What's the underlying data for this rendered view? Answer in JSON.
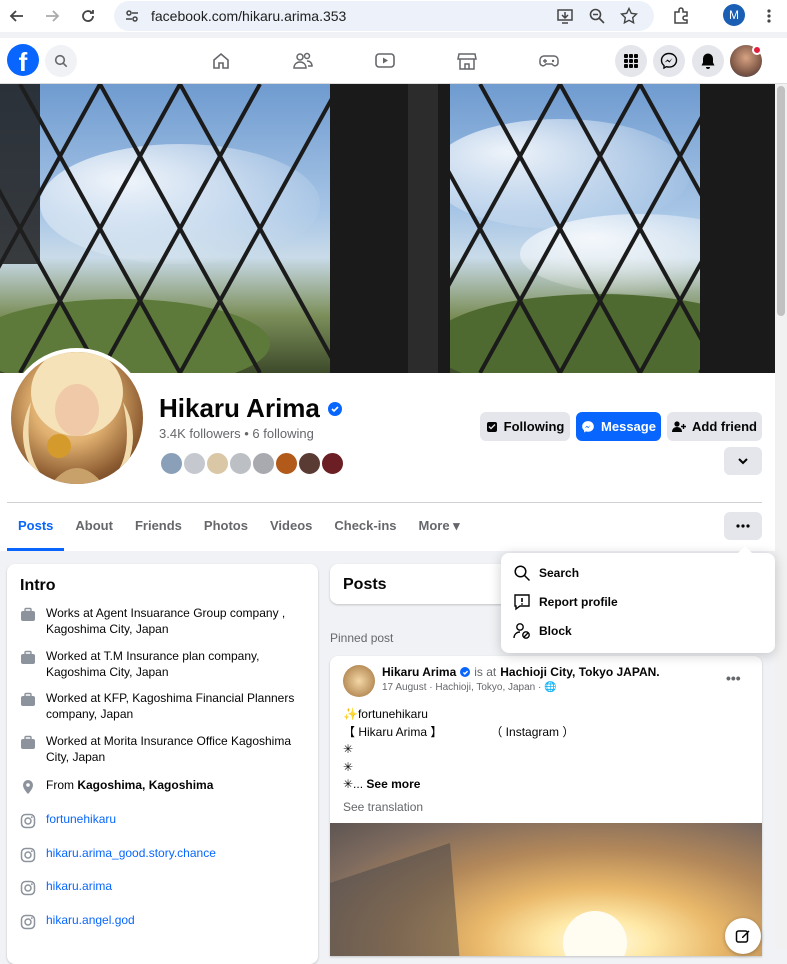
{
  "browser": {
    "url": "facebook.com/hikaru.arima.353",
    "profile_initial": "M"
  },
  "fb": {
    "logo_letter": "f"
  },
  "profile": {
    "name": "Hikaru Arima",
    "followers_line": "3.4K followers • 6 following",
    "buttons": {
      "following": "Following",
      "message": "Message",
      "add_friend": "Add friend"
    }
  },
  "tabs": [
    "Posts",
    "About",
    "Friends",
    "Photos",
    "Videos",
    "Check-ins",
    "More ▾"
  ],
  "intro": {
    "title": "Intro",
    "work": [
      "Works at Agent Insuarance Group company , Kagoshima City, Japan",
      "Worked at T.M Insurance plan company, Kagoshima City, Japan",
      "Worked at KFP, Kagoshima Financial Planners company, Japan",
      "Worked at Morita Insurance Office Kagoshima City, Japan"
    ],
    "from_prefix": "From ",
    "from_place": "Kagoshima, Kagoshima",
    "links": [
      "fortunehikaru",
      "hikaru.arima_good.story.chance",
      "hikaru.arima",
      "hikaru.angel.god"
    ]
  },
  "posts_header": "Posts",
  "pinned_label": "Pinned post",
  "post": {
    "author": "Hikaru Arima",
    "is_at": "is at",
    "location": "Hachioji City, Tokyo JAPAN.",
    "meta": "17 August · Hachioji, Tokyo, Japan · 🌐",
    "line1": "✨fortunehikaru",
    "line2": "【 Hikaru Arima 】　　　　　（ Instagram ）",
    "line3": "✳",
    "line4": "✳",
    "line5_prefix": "✳... ",
    "see_more": "See more",
    "see_translation": "See translation"
  },
  "menu": {
    "items": [
      {
        "label": "Search",
        "icon": "search-icon"
      },
      {
        "label": "Report profile",
        "icon": "report-icon"
      },
      {
        "label": "Block",
        "icon": "block-user-icon"
      }
    ]
  },
  "colors": {
    "accent": "#0866ff",
    "grey_button": "#e4e6eb",
    "background": "#f0f2f5"
  }
}
